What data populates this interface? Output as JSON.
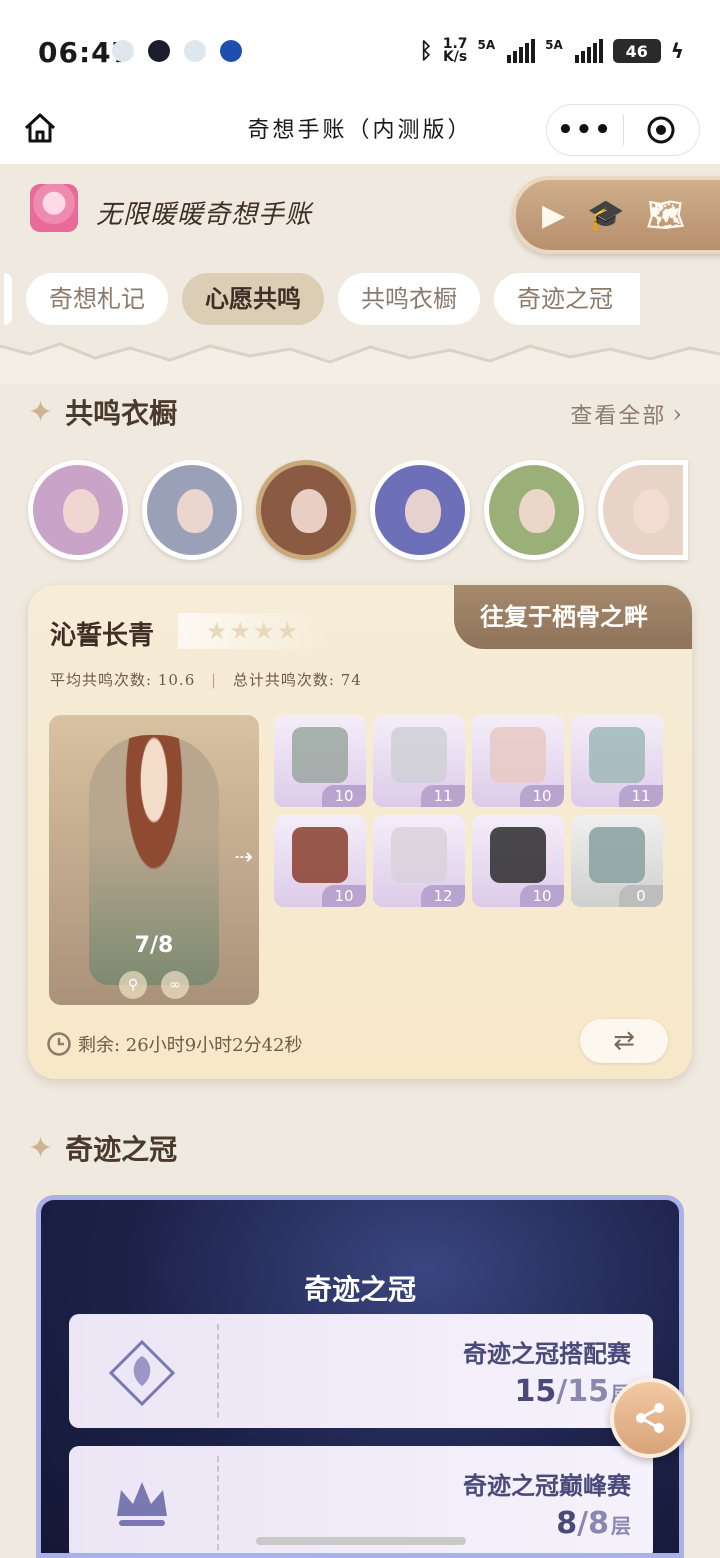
{
  "status_bar": {
    "time": "06:47",
    "net_speed_value": "1.7",
    "net_speed_unit": "K/s",
    "sim1_label": "5A",
    "sim2_label": "5A",
    "battery": "46"
  },
  "nav": {
    "title": "奇想手账（内测版）",
    "more_label": "•••"
  },
  "header": {
    "app_name": "无限暖暖奇想手账"
  },
  "tabs": [
    {
      "label": "奇想札记"
    },
    {
      "label": "心愿共鸣"
    },
    {
      "label": "共鸣衣橱"
    },
    {
      "label": "奇迹之冠"
    }
  ],
  "wardrobe": {
    "section_title": "共鸣衣橱",
    "see_all": "查看全部",
    "avatar_colors": [
      "#c9a3c8",
      "#9aa0b8",
      "#8b5a42",
      "#6d6fb8",
      "#9bb079",
      "#e8d3c7"
    ],
    "card": {
      "name": "沁誓长青",
      "stars": "★★★★",
      "banner": "往复于栖骨之畔",
      "avg_label": "平均共鸣次数:",
      "avg_value": "10.6",
      "total_label": "总计共鸣次数:",
      "total_value": "74",
      "progress": "7/8",
      "items": [
        {
          "count": "10",
          "color": "#9aa7a0"
        },
        {
          "count": "11",
          "color": "#cfcfd6"
        },
        {
          "count": "10",
          "color": "#e8c9c4"
        },
        {
          "count": "11",
          "color": "#9fb8b8"
        },
        {
          "count": "10",
          "color": "#8a3f2c"
        },
        {
          "count": "12",
          "color": "#d8d2dc"
        },
        {
          "count": "10",
          "color": "#2a2a2a"
        },
        {
          "count": "0",
          "color": "#8aa0a0"
        }
      ],
      "remain": "剩余: 26小时9小时2分42秒"
    }
  },
  "crown": {
    "section_title": "奇迹之冠",
    "panel_title": "奇迹之冠",
    "rows": [
      {
        "title": "奇迹之冠搭配赛",
        "current": "15",
        "total": "/15",
        "unit": "层"
      },
      {
        "title": "奇迹之冠巅峰赛",
        "current": "8",
        "total": "/8",
        "unit": "层"
      }
    ]
  }
}
